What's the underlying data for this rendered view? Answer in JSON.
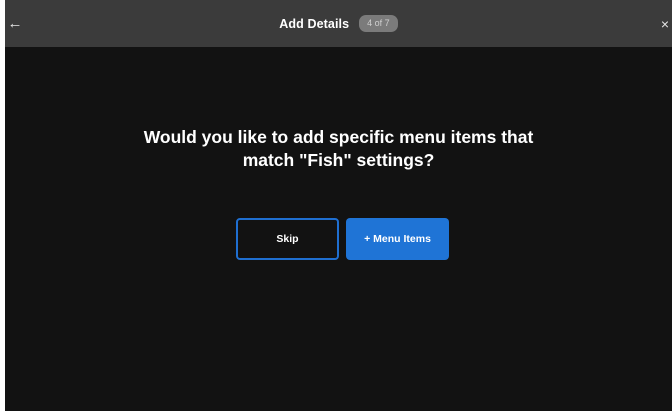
{
  "header": {
    "title": "Add Details",
    "step_badge": "4 of 7",
    "back_icon": "←",
    "close_icon": "×"
  },
  "main": {
    "question_line1": "Would you like to add specific menu items that",
    "question_line2": "match \"Fish\" settings?"
  },
  "actions": {
    "skip_label": "Skip",
    "add_label": "+ Menu Items"
  },
  "colors": {
    "background": "#121212",
    "header": "#3b3b3b",
    "accent": "#1f74d6"
  }
}
